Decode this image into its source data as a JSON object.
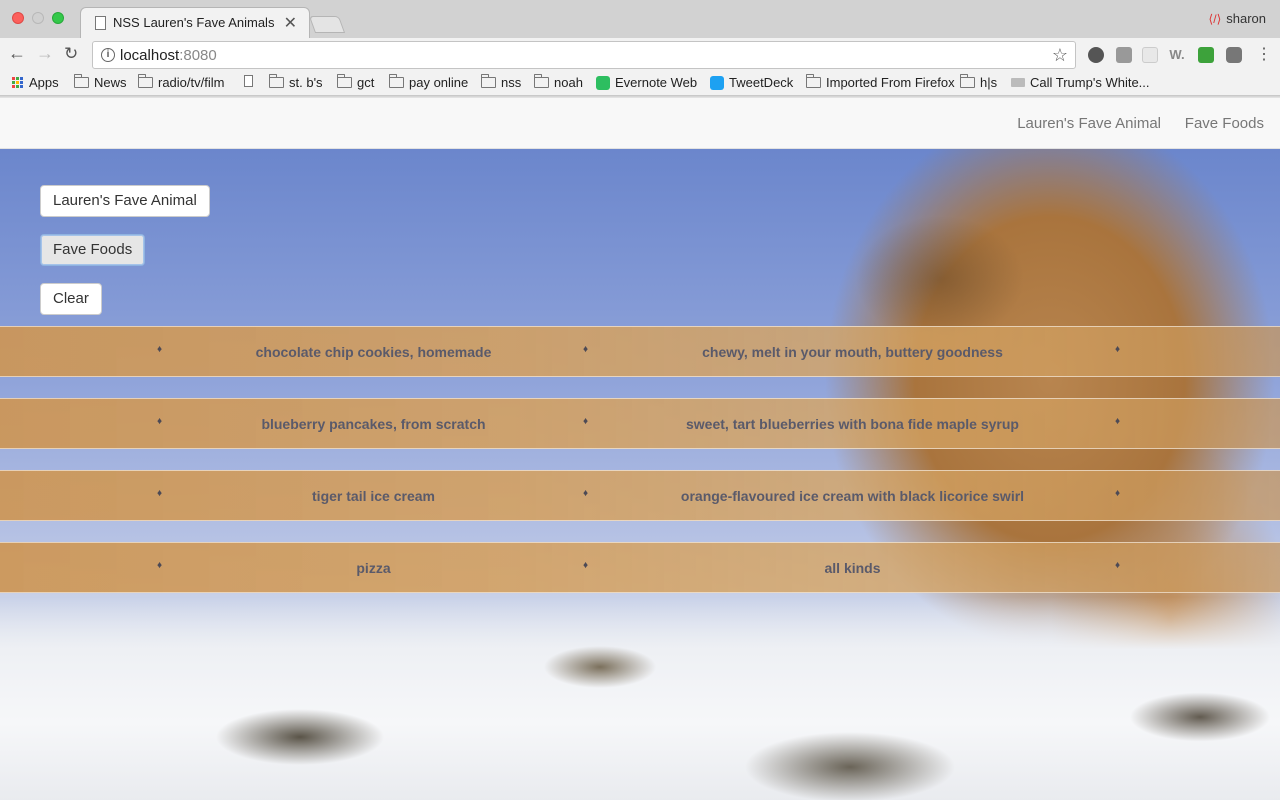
{
  "browser": {
    "tab_title": "NSS Lauren's Fave Animals",
    "tab_close": "✕",
    "profile_name": "sharon",
    "url_host": "localhost",
    "url_port": ":8080",
    "bookmarks": [
      "Apps",
      "News",
      "radio/tv/film",
      "",
      "st. b's",
      "gct",
      "pay online",
      "nss",
      "noah",
      "Evernote Web",
      "TweetDeck",
      "Imported From Firefox",
      "h|s",
      "Call Trump's White..."
    ]
  },
  "navbar": {
    "links": [
      "Lauren's Fave Animal",
      "Fave Foods"
    ]
  },
  "buttons": {
    "animal": "Lauren's Fave Animal",
    "foods": "Fave Foods",
    "clear": "Clear"
  },
  "foods": [
    {
      "name": "chocolate chip cookies, homemade",
      "description": "chewy, melt in your mouth, buttery goodness"
    },
    {
      "name": "blueberry pancakes, from scratch",
      "description": "sweet, tart blueberries with bona fide maple syrup"
    },
    {
      "name": "tiger tail ice cream",
      "description": "orange-flavoured ice cream with black licorice swirl"
    },
    {
      "name": "pizza",
      "description": "all kinds"
    }
  ],
  "bullet_glyph": "♦",
  "colors": {
    "row_tint": "#d4a05f",
    "row_text": "#5a5a6a",
    "nav_text": "#777777",
    "focus_border": "#8fb3e0"
  },
  "icons": {
    "reload": "reload-icon",
    "star": "star-icon",
    "info": "info-icon",
    "menu": "menu-icon",
    "background": "cougar-in-snow-photo"
  }
}
